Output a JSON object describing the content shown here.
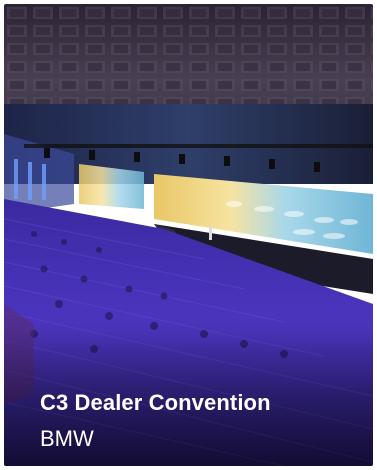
{
  "card": {
    "title": "C3 Dealer Convention",
    "subtitle": "BMW",
    "image_subject": "convention-hall-photo"
  },
  "colors": {
    "text": "#ffffff",
    "seat_purple": "#4a34b8",
    "ceiling": "#3b3048",
    "screen_glow": "#f2d37a"
  }
}
